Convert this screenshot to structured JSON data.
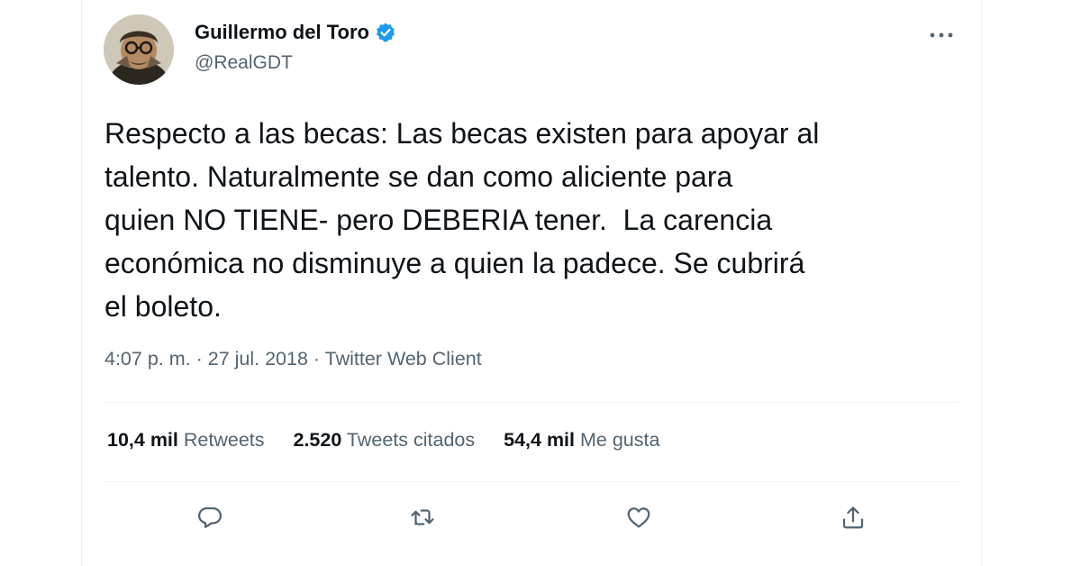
{
  "user": {
    "name": "Guillermo del Toro",
    "handle": "@RealGDT"
  },
  "icons": {
    "verified": "verified-badge-icon",
    "more": "more-options-icon",
    "reply": "reply-icon",
    "retweet": "retweet-icon",
    "like": "like-icon",
    "share": "share-icon"
  },
  "colors": {
    "text": "#0f1419",
    "secondary": "#536471",
    "verified": "#1d9bf0",
    "divider": "#eff3f4"
  },
  "tweet": {
    "lines": [
      "Respecto a las becas: Las becas existen para apoyar al",
      "talento. Naturalmente se dan como aliciente para",
      "quien NO TIENE- pero DEBERIA tener.  La carencia",
      "económica no disminuye a quien la padece. Se cubrirá",
      "el boleto."
    ],
    "time": "4:07 p. m.",
    "date": "27 jul. 2018",
    "client": "Twitter Web Client"
  },
  "stats": {
    "retweets_count": "10,4 mil",
    "retweets_label": "Retweets",
    "quotes_count": "2.520",
    "quotes_label": "Tweets citados",
    "likes_count": "54,4 mil",
    "likes_label": "Me gusta"
  }
}
